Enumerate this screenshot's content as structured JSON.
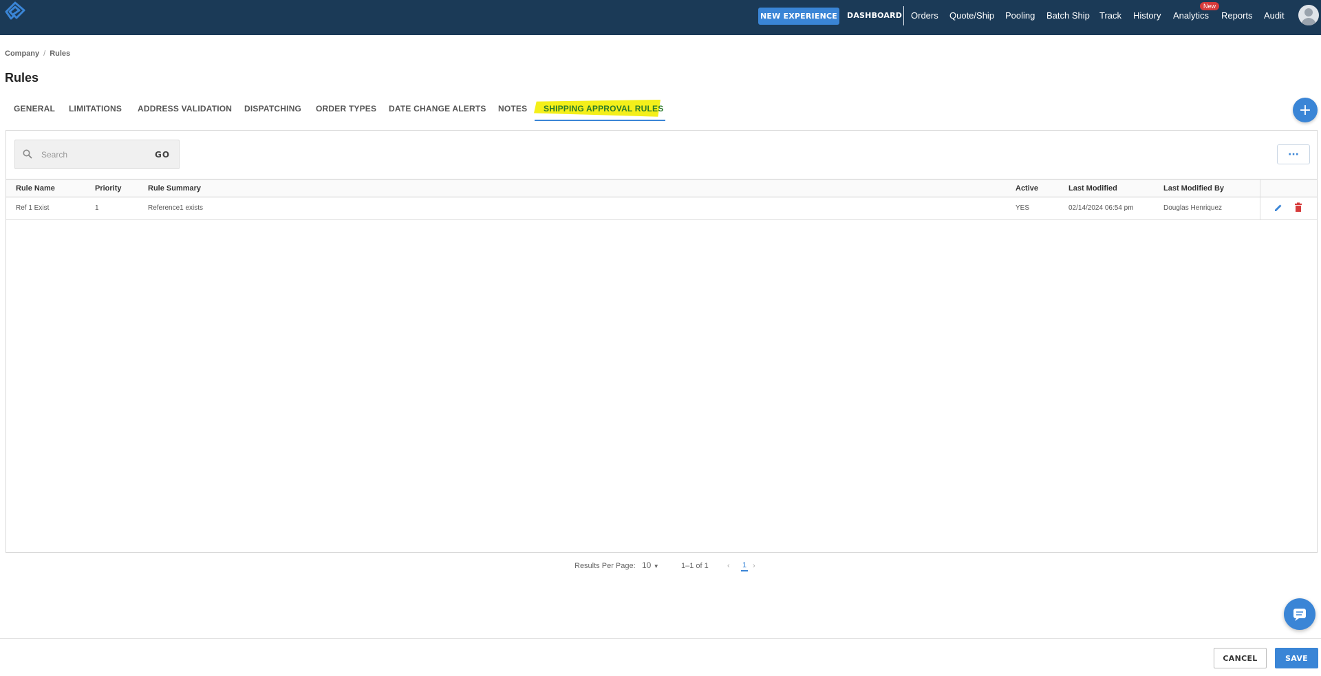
{
  "topbar": {
    "new_experience": "NEW EXPERIENCE",
    "dashboard": "DASHBOARD",
    "nav": [
      "Orders",
      "Quote/Ship",
      "Pooling",
      "Batch Ship",
      "Track",
      "History",
      "Analytics",
      "Reports",
      "Audit"
    ],
    "analytics_badge": "New"
  },
  "breadcrumb": {
    "company": "Company",
    "separator": "/",
    "rules": "Rules"
  },
  "page": {
    "title": "Rules"
  },
  "tabs": [
    "GENERAL",
    "LIMITATIONS",
    "ADDRESS VALIDATION",
    "DISPATCHING",
    "ORDER TYPES",
    "DATE CHANGE ALERTS",
    "NOTES",
    "SHIPPING APPROVAL RULES"
  ],
  "active_tab": "SHIPPING APPROVAL RULES",
  "add_button": "+",
  "search": {
    "placeholder": "Search",
    "go": "GO"
  },
  "more_button": "···",
  "table": {
    "columns": [
      "Rule Name",
      "Priority",
      "Rule Summary",
      "Active",
      "Last Modified",
      "Last Modified By"
    ],
    "rows": [
      {
        "rule_name": "Ref 1 Exist",
        "priority": "1",
        "summary": "Reference1 exists",
        "active": "YES",
        "modified": "02/14/2024 06:54 pm",
        "modified_by": "Douglas Henriquez"
      }
    ]
  },
  "pagination": {
    "results_label": "Results Per Page:",
    "per_page": "10",
    "range": "1–1 of 1",
    "current_page": "1"
  },
  "footer": {
    "cancel": "CANCEL",
    "save": "SAVE"
  },
  "colors": {
    "topbar": "#1b3a57",
    "accent": "#3a85d6",
    "highlight": "#f4ef1a",
    "delete": "#d63b3b"
  }
}
